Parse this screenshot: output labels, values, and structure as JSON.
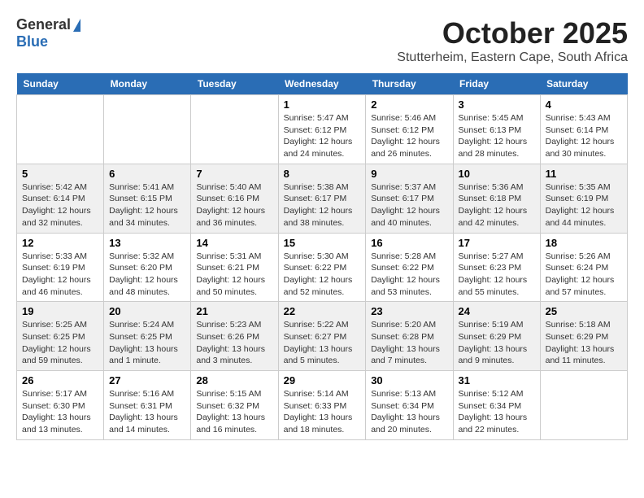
{
  "logo": {
    "general": "General",
    "blue": "Blue"
  },
  "title": "October 2025",
  "subtitle": "Stutterheim, Eastern Cape, South Africa",
  "days_of_week": [
    "Sunday",
    "Monday",
    "Tuesday",
    "Wednesday",
    "Thursday",
    "Friday",
    "Saturday"
  ],
  "weeks": [
    [
      {
        "day": "",
        "info": ""
      },
      {
        "day": "",
        "info": ""
      },
      {
        "day": "",
        "info": ""
      },
      {
        "day": "1",
        "info": "Sunrise: 5:47 AM\nSunset: 6:12 PM\nDaylight: 12 hours\nand 24 minutes."
      },
      {
        "day": "2",
        "info": "Sunrise: 5:46 AM\nSunset: 6:12 PM\nDaylight: 12 hours\nand 26 minutes."
      },
      {
        "day": "3",
        "info": "Sunrise: 5:45 AM\nSunset: 6:13 PM\nDaylight: 12 hours\nand 28 minutes."
      },
      {
        "day": "4",
        "info": "Sunrise: 5:43 AM\nSunset: 6:14 PM\nDaylight: 12 hours\nand 30 minutes."
      }
    ],
    [
      {
        "day": "5",
        "info": "Sunrise: 5:42 AM\nSunset: 6:14 PM\nDaylight: 12 hours\nand 32 minutes."
      },
      {
        "day": "6",
        "info": "Sunrise: 5:41 AM\nSunset: 6:15 PM\nDaylight: 12 hours\nand 34 minutes."
      },
      {
        "day": "7",
        "info": "Sunrise: 5:40 AM\nSunset: 6:16 PM\nDaylight: 12 hours\nand 36 minutes."
      },
      {
        "day": "8",
        "info": "Sunrise: 5:38 AM\nSunset: 6:17 PM\nDaylight: 12 hours\nand 38 minutes."
      },
      {
        "day": "9",
        "info": "Sunrise: 5:37 AM\nSunset: 6:17 PM\nDaylight: 12 hours\nand 40 minutes."
      },
      {
        "day": "10",
        "info": "Sunrise: 5:36 AM\nSunset: 6:18 PM\nDaylight: 12 hours\nand 42 minutes."
      },
      {
        "day": "11",
        "info": "Sunrise: 5:35 AM\nSunset: 6:19 PM\nDaylight: 12 hours\nand 44 minutes."
      }
    ],
    [
      {
        "day": "12",
        "info": "Sunrise: 5:33 AM\nSunset: 6:19 PM\nDaylight: 12 hours\nand 46 minutes."
      },
      {
        "day": "13",
        "info": "Sunrise: 5:32 AM\nSunset: 6:20 PM\nDaylight: 12 hours\nand 48 minutes."
      },
      {
        "day": "14",
        "info": "Sunrise: 5:31 AM\nSunset: 6:21 PM\nDaylight: 12 hours\nand 50 minutes."
      },
      {
        "day": "15",
        "info": "Sunrise: 5:30 AM\nSunset: 6:22 PM\nDaylight: 12 hours\nand 52 minutes."
      },
      {
        "day": "16",
        "info": "Sunrise: 5:28 AM\nSunset: 6:22 PM\nDaylight: 12 hours\nand 53 minutes."
      },
      {
        "day": "17",
        "info": "Sunrise: 5:27 AM\nSunset: 6:23 PM\nDaylight: 12 hours\nand 55 minutes."
      },
      {
        "day": "18",
        "info": "Sunrise: 5:26 AM\nSunset: 6:24 PM\nDaylight: 12 hours\nand 57 minutes."
      }
    ],
    [
      {
        "day": "19",
        "info": "Sunrise: 5:25 AM\nSunset: 6:25 PM\nDaylight: 12 hours\nand 59 minutes."
      },
      {
        "day": "20",
        "info": "Sunrise: 5:24 AM\nSunset: 6:25 PM\nDaylight: 13 hours\nand 1 minute."
      },
      {
        "day": "21",
        "info": "Sunrise: 5:23 AM\nSunset: 6:26 PM\nDaylight: 13 hours\nand 3 minutes."
      },
      {
        "day": "22",
        "info": "Sunrise: 5:22 AM\nSunset: 6:27 PM\nDaylight: 13 hours\nand 5 minutes."
      },
      {
        "day": "23",
        "info": "Sunrise: 5:20 AM\nSunset: 6:28 PM\nDaylight: 13 hours\nand 7 minutes."
      },
      {
        "day": "24",
        "info": "Sunrise: 5:19 AM\nSunset: 6:29 PM\nDaylight: 13 hours\nand 9 minutes."
      },
      {
        "day": "25",
        "info": "Sunrise: 5:18 AM\nSunset: 6:29 PM\nDaylight: 13 hours\nand 11 minutes."
      }
    ],
    [
      {
        "day": "26",
        "info": "Sunrise: 5:17 AM\nSunset: 6:30 PM\nDaylight: 13 hours\nand 13 minutes."
      },
      {
        "day": "27",
        "info": "Sunrise: 5:16 AM\nSunset: 6:31 PM\nDaylight: 13 hours\nand 14 minutes."
      },
      {
        "day": "28",
        "info": "Sunrise: 5:15 AM\nSunset: 6:32 PM\nDaylight: 13 hours\nand 16 minutes."
      },
      {
        "day": "29",
        "info": "Sunrise: 5:14 AM\nSunset: 6:33 PM\nDaylight: 13 hours\nand 18 minutes."
      },
      {
        "day": "30",
        "info": "Sunrise: 5:13 AM\nSunset: 6:34 PM\nDaylight: 13 hours\nand 20 minutes."
      },
      {
        "day": "31",
        "info": "Sunrise: 5:12 AM\nSunset: 6:34 PM\nDaylight: 13 hours\nand 22 minutes."
      },
      {
        "day": "",
        "info": ""
      }
    ]
  ]
}
